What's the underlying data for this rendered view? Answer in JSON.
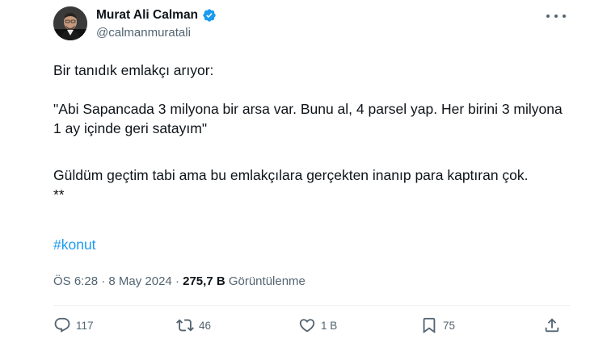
{
  "author": {
    "display_name": "Murat Ali Calman",
    "handle": "@calmanmuratali",
    "verified_color": "#1d9bf0"
  },
  "post": {
    "line1": "Bir tanıdık emlakçı arıyor:",
    "line2": "\"Abi Sapancada 3 milyona bir arsa var. Bunu al, 4 parsel yap. Her birini 3 milyona 1 ay içinde geri satayım\"",
    "line3": "Güldüm geçtim tabi ama bu emlakçılara gerçekten inanıp para kaptıran çok.\n**",
    "hashtag": "#konut"
  },
  "meta": {
    "time": "ÖS 6:28",
    "separator1": " · ",
    "date": "8 May 2024",
    "separator2": " · ",
    "views_count": "275,7 B",
    "views_label": " Görüntülenme"
  },
  "actions": {
    "replies": "117",
    "reposts": "46",
    "likes": "1 B",
    "bookmarks": "75"
  },
  "icons": {
    "more": "more-icon",
    "reply": "reply-icon",
    "repost": "repost-icon",
    "like": "heart-icon",
    "bookmark": "bookmark-icon",
    "share": "share-icon"
  }
}
